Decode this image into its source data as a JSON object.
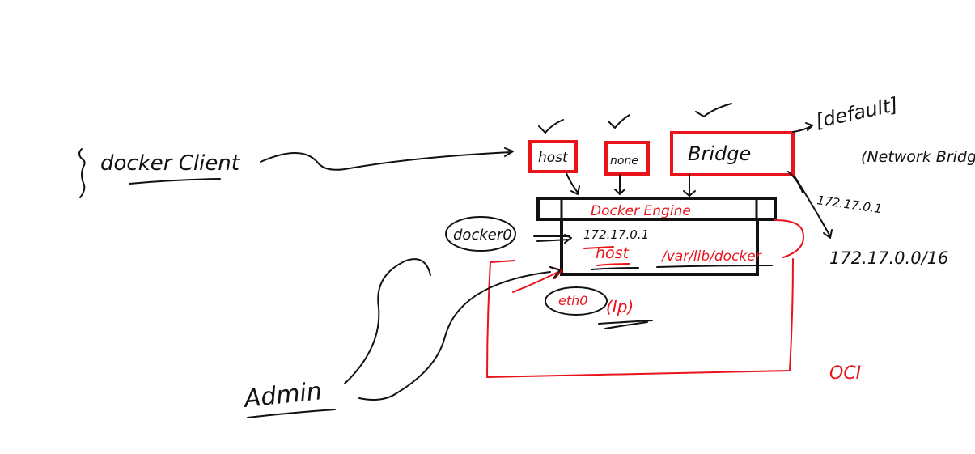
{
  "labels": {
    "docker_client": "docker Client",
    "host": "host",
    "none": "none",
    "bridge": "Bridge",
    "default": "[default]",
    "network_bridge": "(Network Bridge)",
    "bridge_ip": "172.17.0.1",
    "docker_engine": "Docker Engine",
    "docker0": "docker0",
    "engine_ip": "172.17.0.1",
    "engine_host": "host",
    "var_lib_docker": "/var/lib/docker",
    "eth0": "eth0",
    "ip": "(Ip)",
    "subnet": "172.17.0.0/16",
    "admin": "Admin",
    "oci": "OCI"
  },
  "colors": {
    "ink": "#111111",
    "accent": "#e8131b",
    "background": "#ffffff"
  }
}
